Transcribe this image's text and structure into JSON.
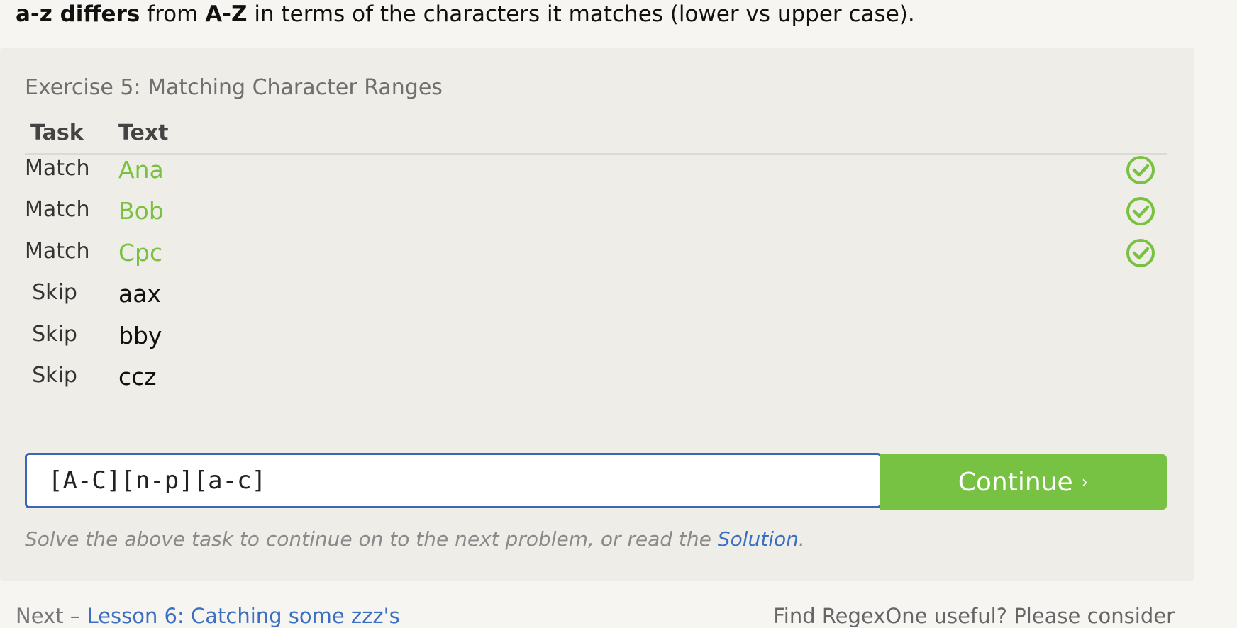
{
  "intro": {
    "part1": "a-z differs",
    "part2": " from ",
    "part3": "A-Z",
    "part4": " in terms of the characters it matches (lower vs upper case)."
  },
  "exercise": {
    "title": "Exercise 5: Matching Character Ranges",
    "col_task": "Task",
    "col_text": "Text",
    "rows": [
      {
        "task": "Match",
        "text": "Ana",
        "status": "check-icon"
      },
      {
        "task": "Match",
        "text": "Bob",
        "status": "check-icon"
      },
      {
        "task": "Match",
        "text": "Cpc",
        "status": "check-icon"
      },
      {
        "task": "Skip",
        "text": "aax"
      },
      {
        "task": "Skip",
        "text": "bby"
      },
      {
        "task": "Skip",
        "text": "ccz"
      }
    ],
    "answer_value": "[A-C][n-p][a-c]",
    "continue_label": "Continue",
    "continue_chevron": "›",
    "hint_prefix": "Solve the above task to continue on to the next problem, or read the ",
    "hint_link": "Solution",
    "hint_suffix": "."
  },
  "footer": {
    "next_prefix": "Next – ",
    "next_link": "Lesson 6: Catching some zzz's",
    "useful_text": "Find RegexOne useful? Please consider"
  },
  "colors": {
    "match_green": "#7ac142",
    "button_green": "#77c143",
    "input_border": "#3a66b8",
    "link_blue": "#3a6fc1"
  }
}
